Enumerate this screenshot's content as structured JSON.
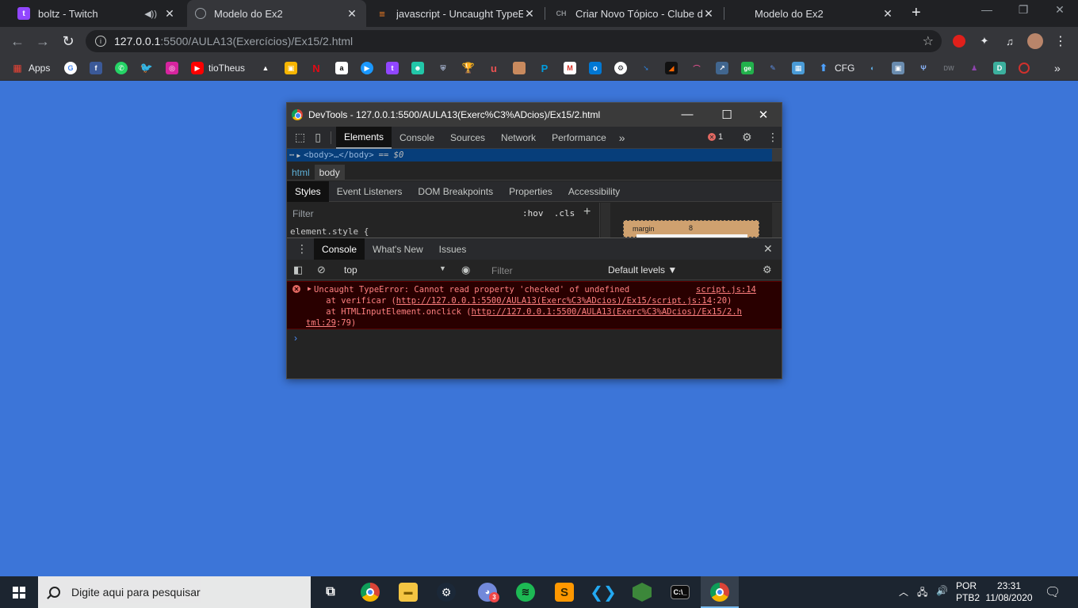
{
  "tabs": [
    {
      "title": "boltz - Twitch",
      "icon": "twitch-icon",
      "color": "#9146ff",
      "audio": true,
      "active": false
    },
    {
      "title": "Modelo do Ex2",
      "icon": "globe-icon",
      "color": "#9aa0a6",
      "audio": false,
      "active": true
    },
    {
      "title": "javascript - Uncaught TypeError",
      "icon": "stackoverflow-icon",
      "color": "#f48024",
      "audio": false,
      "active": false
    },
    {
      "title": "Criar Novo Tópico - Clube do Hardware",
      "icon": "clubedohardware-icon",
      "color": "#5f6368",
      "audio": false,
      "active": false
    },
    {
      "title": "Modelo do Ex2",
      "icon": "globe-icon",
      "color": "#9aa0a6",
      "audio": false,
      "active": false
    }
  ],
  "address": {
    "host": "127.0.0.1",
    "path": ":5500/AULA13(Exercícios)/Ex15/2.html"
  },
  "bookmarks": {
    "apps": "Apps",
    "tiotheus": "tioTheus",
    "cfg": "CFG"
  },
  "devtools": {
    "title": "DevTools - 127.0.0.1:5500/AULA13(Exerc%C3%ADcios)/Ex15/2.html",
    "main_tabs": [
      "Elements",
      "Console",
      "Sources",
      "Network",
      "Performance"
    ],
    "error_count": "1",
    "dom_line": "<body>…</body>",
    "dom_eq": "== $0",
    "breadcrumbs": [
      "html",
      "body"
    ],
    "sub_tabs": [
      "Styles",
      "Event Listeners",
      "DOM Breakpoints",
      "Properties",
      "Accessibility"
    ],
    "styles_filter": "Filter",
    "hov": ":hov",
    "cls": ".cls",
    "element_style": "element.style {",
    "margin_label": "margin",
    "margin_value": "8",
    "drawer_tabs": [
      "Console",
      "What's New",
      "Issues"
    ],
    "context": "top",
    "console_filter": "Filter",
    "levels": "Default levels ▼",
    "error": {
      "message": "Uncaught TypeError: Cannot read property 'checked' of undefined",
      "source": "script.js:14",
      "stack1_prefix": "    at verificar (",
      "stack1_link": "http://127.0.0.1:5500/AULA13(Exerc%C3%ADcios)/Ex15/script.js:14",
      "stack1_suffix": ":20)",
      "stack2_prefix": "    at HTMLInputElement.onclick (",
      "stack2_link": "http://127.0.0.1:5500/AULA13(Exerc%C3%ADcios)/Ex15/2.h",
      "stack2_link_cont": "tml:29",
      "stack2_suffix": ":79)"
    },
    "prompt": "›"
  },
  "taskbar": {
    "search_placeholder": "Digite aqui para pesquisar",
    "language": "POR",
    "keyboard": "PTB2",
    "time": "23:31",
    "date": "11/08/2020",
    "discord_badge": "3"
  }
}
